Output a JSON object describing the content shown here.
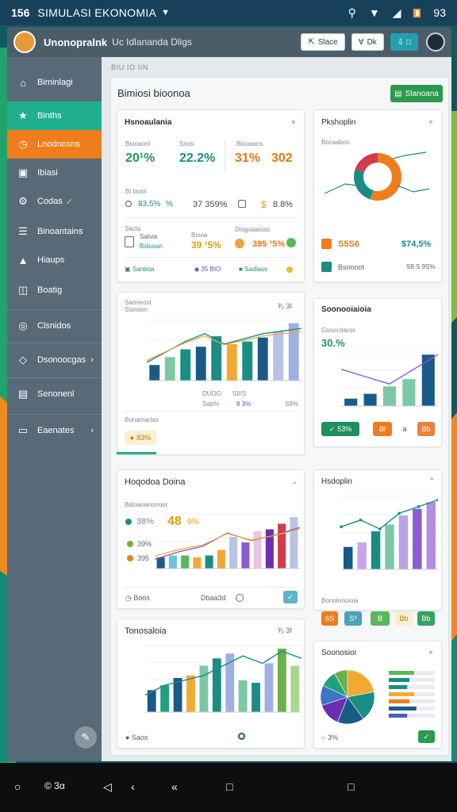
{
  "status": {
    "time": "156",
    "app_title": "SIMULASI EKONOMIA",
    "battery": "93"
  },
  "appbar": {
    "title": "Unonopralnk",
    "subtitle": "Uc Idlananda Dligs",
    "btn1": "Slace",
    "btn2": "Dk",
    "btn3": ""
  },
  "sidebar": {
    "items": [
      {
        "label": "Biminlagi",
        "icon": "home-icon"
      },
      {
        "label": "Binths",
        "icon": "star-icon",
        "state": "active-green"
      },
      {
        "label": "Lnodnosns",
        "icon": "clock-icon",
        "state": "active-orange"
      },
      {
        "label": "Ibiasi",
        "icon": "inbox-icon"
      },
      {
        "label": "Codas",
        "icon": "gear-icon"
      },
      {
        "label": "Binoantains",
        "icon": "layers-icon"
      },
      {
        "label": "Hiaups",
        "icon": "chart-icon"
      },
      {
        "label": "Boatig",
        "icon": "filter-icon"
      },
      {
        "label": "Clsnidos",
        "icon": "target-icon"
      },
      {
        "label": "Dsonoocgas",
        "icon": "tag-icon"
      },
      {
        "label": "Senonenl",
        "icon": "card-icon"
      },
      {
        "label": "Eaenates",
        "icon": "folder-icon"
      }
    ]
  },
  "breadcrumb": "BIU  IO  IIN",
  "panel": {
    "title": "Bimiosi bioonoa",
    "action": "Slanoana"
  },
  "card1": {
    "title": "Hsnoaulania",
    "lab1": "Biooaonl",
    "lab2": "Snos",
    "lab3": "Blooaans",
    "v1": "20¹%",
    "v2": "22.2%",
    "v3": "31%",
    "v4": "302",
    "rowlab": "Bl bioot",
    "r1a": "83.5%",
    "r1b": "%",
    "r1c": "37 359%",
    "r1d": "$",
    "r1e": "8.8%",
    "box_lab": "Sacla",
    "box_val": "Satvia",
    "box_sub": "Bolusan",
    "mlab1": "Biooa",
    "mlab2": "Diogoaaioas",
    "m1": "39 ¹5%",
    "m2": "395 ¹5%",
    "f1": "Sanboa",
    "f2": "35 BIO",
    "f3": "Sadlaos"
  },
  "card2": {
    "title": "Pkshoplin",
    "lab": "Bocaabos",
    "v1": "S5S6",
    "v2": "$74,5%",
    "row": "Bsnooot",
    "rowval": "S9.S 9S%"
  },
  "card3": {
    "title": "Saoneost",
    "ylab": "Sisnoon",
    "x_badge": "³⁄₂ 3I",
    "footlab1": "DUOO",
    "footlab2": "SIIIS",
    "footv1": "Sab%",
    "footv2": "8 3%",
    "footv3": "S9%",
    "sublab": "Bonamarlas",
    "chip": "83%"
  },
  "card4": {
    "title": "Soonooiaioia",
    "lab": "Gsnocdaros",
    "big": "30.%",
    "c1": "53%",
    "c2": "Bl",
    "c3": "a",
    "c4": "Bb"
  },
  "card5": {
    "title": "Hoqodoa Doina",
    "lab": "Bidoaoanonoor",
    "v1": "38%",
    "v2": "48",
    "v3": "0%",
    "v4": "39%",
    "v5": "395",
    "f1": "Boos",
    "f2": "Dbaa3d",
    "f3": "✓"
  },
  "card6": {
    "title": "Hsdoplin",
    "lab": "Bonotonoioia",
    "c1": "6S",
    "c2": "S³",
    "c3": "B",
    "c4": "Bb",
    "c5": "Bb"
  },
  "card7": {
    "title": "Tonosaloia",
    "badge": "³⁄₂ 3I",
    "f1": "Saos"
  },
  "card8": {
    "title": "Soonosioi",
    "f1": "3%"
  },
  "chart_data": [
    {
      "type": "bar",
      "title": "Saoneost",
      "values": [
        12,
        18,
        24,
        26,
        34,
        28,
        30,
        33,
        38,
        44
      ],
      "line": [
        14,
        22,
        30,
        36,
        28,
        32,
        36,
        38,
        40
      ]
    },
    {
      "type": "pie",
      "title": "Pkshoplin",
      "values": [
        55,
        25,
        20
      ]
    },
    {
      "type": "bar",
      "title": "Soonooiaioia",
      "values": [
        6,
        10,
        16,
        22,
        42
      ],
      "line": [
        30,
        24,
        18,
        30,
        42
      ]
    },
    {
      "type": "bar",
      "title": "Hoqodoa Doina",
      "values": [
        12,
        14,
        14,
        12,
        14,
        20,
        34,
        28,
        40,
        42,
        48,
        55
      ],
      "line": [
        10,
        18,
        24,
        38,
        30,
        36,
        44
      ]
    },
    {
      "type": "bar",
      "title": "Hsdoplin",
      "values": [
        20,
        24,
        34,
        40,
        48,
        54,
        60
      ],
      "line": [
        38,
        44,
        36,
        50,
        56,
        62
      ]
    },
    {
      "type": "bar",
      "title": "Tonosaloia",
      "values": [
        18,
        22,
        28,
        30,
        38,
        44,
        48,
        26,
        24,
        40,
        52,
        38
      ],
      "line": [
        14,
        22,
        26,
        30,
        38,
        46,
        40,
        50,
        44
      ]
    },
    {
      "type": "pie",
      "title": "Soonosioi",
      "values": [
        22,
        18,
        16,
        14,
        12,
        10,
        8
      ]
    }
  ],
  "colors": {
    "teal": "#1a8d84",
    "orange": "#ef7d1b",
    "green": "#20b08e",
    "navy": "#1a5a86",
    "purple": "#8d5bd0"
  },
  "navbar": {
    "a": "○",
    "b": "© 3α",
    "c": "◁",
    "d": "‹",
    "e": "«",
    "f": "□",
    "g": "□"
  }
}
